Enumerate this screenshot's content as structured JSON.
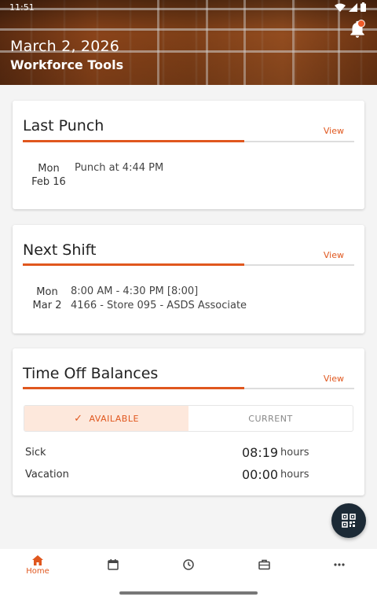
{
  "status_bar": {
    "time": "11:51"
  },
  "header": {
    "date": "March 2, 2026",
    "title": "Workforce Tools"
  },
  "last_punch": {
    "title": "Last Punch",
    "view_label": "View",
    "day": "Mon",
    "date": "Feb 16",
    "text": "Punch at 4:44 PM"
  },
  "next_shift": {
    "title": "Next Shift",
    "view_label": "View",
    "day": "Mon",
    "date": "Mar 2",
    "time": "8:00 AM - 4:30 PM [8:00]",
    "location": "4166 - Store 095 - ASDS Associate"
  },
  "time_off": {
    "title": "Time Off Balances",
    "view_label": "View",
    "tabs": [
      {
        "label": "AVAILABLE",
        "active": true
      },
      {
        "label": "CURRENT",
        "active": false
      }
    ],
    "balances": [
      {
        "label": "Sick",
        "value": "08:19",
        "unit": "hours"
      },
      {
        "label": "Vacation",
        "value": "00:00",
        "unit": "hours"
      }
    ]
  },
  "nav": {
    "items": [
      {
        "icon": "home-icon",
        "label": "Home",
        "active": true
      },
      {
        "icon": "calendar-icon",
        "label": "",
        "active": false
      },
      {
        "icon": "clock-icon",
        "label": "",
        "active": false
      },
      {
        "icon": "briefcase-icon",
        "label": "",
        "active": false
      },
      {
        "icon": "more-icon",
        "label": "",
        "active": false
      }
    ]
  },
  "colors": {
    "accent": "#e0571e",
    "fab": "#1c2a36",
    "active_tab_bg": "#fde8dc"
  }
}
